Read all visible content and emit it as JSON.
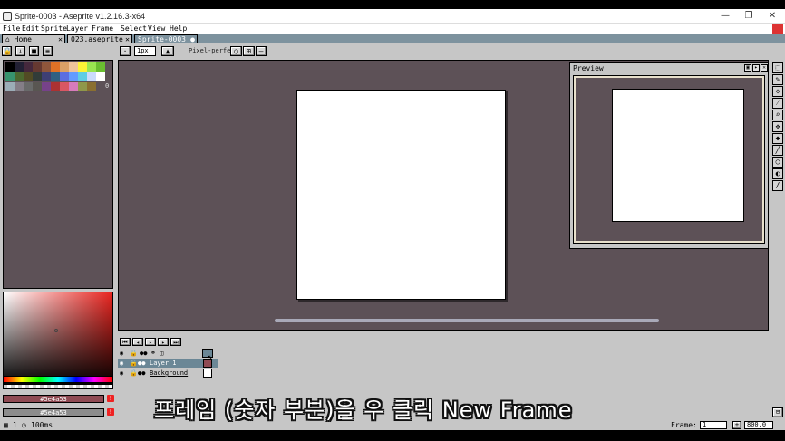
{
  "window": {
    "title": "Sprite-0003 - Aseprite v1.2.16.3-x64",
    "controls": {
      "minimize": "—",
      "maximize": "❐",
      "close": "✕"
    }
  },
  "menu": {
    "items": [
      "File",
      "Edit",
      "Sprite",
      "Layer",
      "Frame",
      "Select",
      "View",
      "Help"
    ]
  },
  "tabs": [
    {
      "label": "Home",
      "close": "✕"
    },
    {
      "label": "023.aseprite",
      "close": "✕"
    },
    {
      "label": "Sprite-0003",
      "close": "●"
    }
  ],
  "context_bar": {
    "brush_size": "1px",
    "pixel_perfect_label": "Pixel-perfect"
  },
  "palette": {
    "colors": [
      "#000000",
      "#222034",
      "#45283c",
      "#663931",
      "#8f563b",
      "#df7126",
      "#d9a066",
      "#eec39a",
      "#fbf236",
      "#99e550",
      "#6abe30",
      "#37946e",
      "#4b692f",
      "#524b24",
      "#323c39",
      "#3f3f74",
      "#306082",
      "#5b6ee1",
      "#639bff",
      "#5fcde4",
      "#cbdbfc",
      "#ffffff",
      "#9badb7",
      "#847e87",
      "#696a6a",
      "#595652",
      "#76428a",
      "#ac3232",
      "#d95763",
      "#d77bba",
      "#8f974a",
      "#8a6f30"
    ],
    "selected_index_label": "0"
  },
  "color_bars": {
    "foreground": {
      "label": "#5e4a53",
      "color": "#8f4a53"
    },
    "background": {
      "label": "#5e4a53",
      "color": "#8c8c8c"
    }
  },
  "preview": {
    "title": "Preview"
  },
  "timeline": {
    "layers": [
      {
        "name": "Layer 1"
      },
      {
        "name": "Background"
      }
    ]
  },
  "status": {
    "frame_number": "1",
    "duration": "100ms",
    "frame_label": "Frame:",
    "frame_value": "1",
    "zoom": "800.0"
  },
  "caption": "프레임 (숫자 부분)을 우 클릭 New Frame",
  "colors": {
    "canvas_bg": "#5d5157",
    "tab_bar": "#7d929e",
    "selected_layer": "#6b8796"
  }
}
